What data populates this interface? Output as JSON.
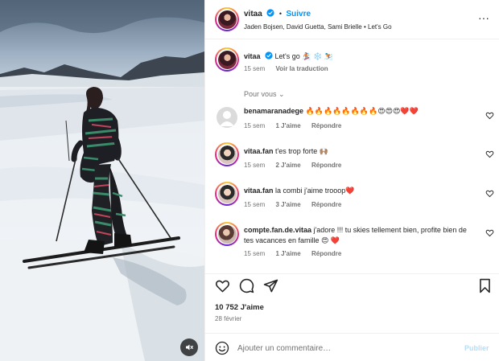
{
  "header": {
    "username": "vitaa",
    "separator": "•",
    "follow_label": "Suivre",
    "subtitle": "Jaden Bojsen, David Guetta, Sami Brielle • Let's Go",
    "more_label": "···"
  },
  "caption": {
    "username": "vitaa",
    "text": "Let's go 🏂 ❄️ ⛷️",
    "time": "15 sem",
    "translate_label": "Voir la traduction"
  },
  "for_you_label": "Pour vous ⌄",
  "comments": [
    {
      "username": "benamaranadege",
      "text": "🔥🔥🔥🔥🔥🔥🔥🔥😍😍😍❤️❤️",
      "time": "15 sem",
      "likes": "1 J'aime",
      "reply": "Répondre"
    },
    {
      "username": "vitaa.fan",
      "text": "t'es trop forte 🙌🏽",
      "time": "15 sem",
      "likes": "2 J'aime",
      "reply": "Répondre"
    },
    {
      "username": "vitaa.fan",
      "text": "la combi j'aime trooop❤️",
      "time": "15 sem",
      "likes": "3 J'aime",
      "reply": "Répondre"
    },
    {
      "username": "compte.fan.de.vitaa",
      "text": "j'adore !!! tu skies tellement bien, profite bien de tes vacances en famille 😍 ❤️",
      "time": "15 sem",
      "likes": "1 J'aime",
      "reply": "Répondre"
    }
  ],
  "actions": {
    "like_icon": "heart-outline-icon",
    "comment_icon": "speech-bubble-icon",
    "share_icon": "paper-plane-icon",
    "save_icon": "bookmark-icon"
  },
  "likes_count": "10 752 J'aime",
  "date": "28 février",
  "composer": {
    "emoji_icon": "smiley-icon",
    "placeholder": "Ajouter un commentaire…",
    "publish_label": "Publier"
  },
  "colors": {
    "accent": "#0095f6",
    "verified": "#0095f6",
    "text": "#262626",
    "muted": "#737373",
    "publish_disabled": "#b2dffc",
    "heart_emoji": "#ed1c5b"
  }
}
